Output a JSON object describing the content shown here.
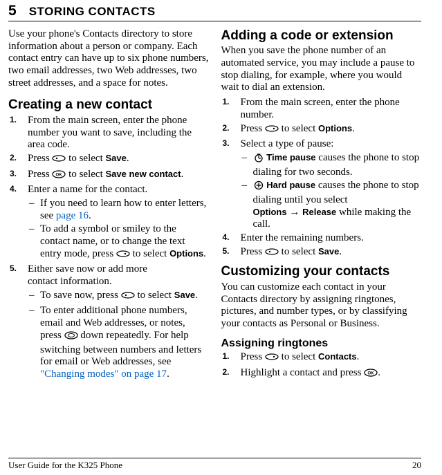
{
  "chapter": {
    "num": "5",
    "title": "STORING CONTACTS"
  },
  "intro": "Use your phone's Contacts directory to store information about a person or company. Each contact entry can have up to six phone numbers, two email addresses, two Web addresses, two street addresses, and a space for notes.",
  "creating": {
    "title": "Creating a new contact",
    "s1": "From the main screen, enter the phone number you want to save, including the area code.",
    "s2a": "Press ",
    "s2b": "to select ",
    "s2c": "Save",
    "s2d": ".",
    "s3a": "Press ",
    "s3b": "to select ",
    "s3c": "Save new contact",
    "s3d": ".",
    "s4": "Enter a name for the contact.",
    "s4sub1a": "If you need to learn how to enter letters, see ",
    "s4sub1b": "page 16",
    "s4sub1c": ".",
    "s4sub2a": "To add a symbol or smiley to the contact name, or to change the text entry mode, press ",
    "s4sub2b": " to select ",
    "s4sub2c": "Options",
    "s4sub2d": ".",
    "s5a": "Either save now or add more",
    "s5b": "contact information.",
    "s5sub1a": "To save now, press ",
    "s5sub1b": " to select ",
    "s5sub1c": "Save",
    "s5sub1d": ".",
    "s5sub2a": "To enter additional phone numbers, email and Web addresses, or notes, press ",
    "s5sub2b": " down repeatedly. For help switching between numbers and letters for email or Web addresses, see ",
    "s5sub2c": "\"Changing modes\" on page 17",
    "s5sub2d": "."
  },
  "adding": {
    "title": "Adding a code or extension",
    "intro": "When you save the phone number of an automated service, you may include a pause to stop dialing, for example, where you would wait to dial an extension.",
    "s1": "From the main screen, enter the phone number.",
    "s2a": "Press ",
    "s2b": " to select ",
    "s2c": "Options",
    "s2d": ".",
    "s3": "Select a type of pause:",
    "s3sub1a": "Time pause",
    "s3sub1b": " causes the phone to stop dialing for two seconds.",
    "s3sub2a": "Hard pause",
    "s3sub2b": " causes the phone to stop dialing until you select",
    "s3sub2c": "Options",
    "s3sub2d": " → ",
    "s3sub2e": "Release",
    "s3sub2f": " while making the call.",
    "s4": "Enter the remaining numbers.",
    "s5a": "Press ",
    "s5b": "to select ",
    "s5c": "Save",
    "s5d": "."
  },
  "customizing": {
    "title": "Customizing your contacts",
    "intro": "You can customize each contact in your Contacts directory by assigning ringtones, pictures, and number types, or by classifying your contacts as Personal or Business."
  },
  "ringtones": {
    "title": "Assigning ringtones",
    "s1a": "Press ",
    "s1b": " to select ",
    "s1c": "Contacts",
    "s1d": ".",
    "s2a": "Highlight a contact and press ",
    "s2b": "."
  },
  "footer": {
    "left": "User Guide for the K325 Phone",
    "right": "20"
  }
}
